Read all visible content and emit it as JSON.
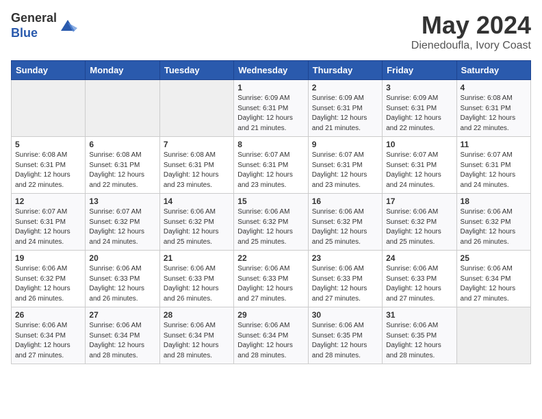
{
  "header": {
    "logo_line1": "General",
    "logo_line2": "Blue",
    "title": "May 2024",
    "location": "Dienedoufla, Ivory Coast"
  },
  "weekdays": [
    "Sunday",
    "Monday",
    "Tuesday",
    "Wednesday",
    "Thursday",
    "Friday",
    "Saturday"
  ],
  "weeks": [
    [
      {
        "num": "",
        "info": ""
      },
      {
        "num": "",
        "info": ""
      },
      {
        "num": "",
        "info": ""
      },
      {
        "num": "1",
        "info": "Sunrise: 6:09 AM\nSunset: 6:31 PM\nDaylight: 12 hours\nand 21 minutes."
      },
      {
        "num": "2",
        "info": "Sunrise: 6:09 AM\nSunset: 6:31 PM\nDaylight: 12 hours\nand 21 minutes."
      },
      {
        "num": "3",
        "info": "Sunrise: 6:09 AM\nSunset: 6:31 PM\nDaylight: 12 hours\nand 22 minutes."
      },
      {
        "num": "4",
        "info": "Sunrise: 6:08 AM\nSunset: 6:31 PM\nDaylight: 12 hours\nand 22 minutes."
      }
    ],
    [
      {
        "num": "5",
        "info": "Sunrise: 6:08 AM\nSunset: 6:31 PM\nDaylight: 12 hours\nand 22 minutes."
      },
      {
        "num": "6",
        "info": "Sunrise: 6:08 AM\nSunset: 6:31 PM\nDaylight: 12 hours\nand 22 minutes."
      },
      {
        "num": "7",
        "info": "Sunrise: 6:08 AM\nSunset: 6:31 PM\nDaylight: 12 hours\nand 23 minutes."
      },
      {
        "num": "8",
        "info": "Sunrise: 6:07 AM\nSunset: 6:31 PM\nDaylight: 12 hours\nand 23 minutes."
      },
      {
        "num": "9",
        "info": "Sunrise: 6:07 AM\nSunset: 6:31 PM\nDaylight: 12 hours\nand 23 minutes."
      },
      {
        "num": "10",
        "info": "Sunrise: 6:07 AM\nSunset: 6:31 PM\nDaylight: 12 hours\nand 24 minutes."
      },
      {
        "num": "11",
        "info": "Sunrise: 6:07 AM\nSunset: 6:31 PM\nDaylight: 12 hours\nand 24 minutes."
      }
    ],
    [
      {
        "num": "12",
        "info": "Sunrise: 6:07 AM\nSunset: 6:31 PM\nDaylight: 12 hours\nand 24 minutes."
      },
      {
        "num": "13",
        "info": "Sunrise: 6:07 AM\nSunset: 6:32 PM\nDaylight: 12 hours\nand 24 minutes."
      },
      {
        "num": "14",
        "info": "Sunrise: 6:06 AM\nSunset: 6:32 PM\nDaylight: 12 hours\nand 25 minutes."
      },
      {
        "num": "15",
        "info": "Sunrise: 6:06 AM\nSunset: 6:32 PM\nDaylight: 12 hours\nand 25 minutes."
      },
      {
        "num": "16",
        "info": "Sunrise: 6:06 AM\nSunset: 6:32 PM\nDaylight: 12 hours\nand 25 minutes."
      },
      {
        "num": "17",
        "info": "Sunrise: 6:06 AM\nSunset: 6:32 PM\nDaylight: 12 hours\nand 25 minutes."
      },
      {
        "num": "18",
        "info": "Sunrise: 6:06 AM\nSunset: 6:32 PM\nDaylight: 12 hours\nand 26 minutes."
      }
    ],
    [
      {
        "num": "19",
        "info": "Sunrise: 6:06 AM\nSunset: 6:32 PM\nDaylight: 12 hours\nand 26 minutes."
      },
      {
        "num": "20",
        "info": "Sunrise: 6:06 AM\nSunset: 6:33 PM\nDaylight: 12 hours\nand 26 minutes."
      },
      {
        "num": "21",
        "info": "Sunrise: 6:06 AM\nSunset: 6:33 PM\nDaylight: 12 hours\nand 26 minutes."
      },
      {
        "num": "22",
        "info": "Sunrise: 6:06 AM\nSunset: 6:33 PM\nDaylight: 12 hours\nand 27 minutes."
      },
      {
        "num": "23",
        "info": "Sunrise: 6:06 AM\nSunset: 6:33 PM\nDaylight: 12 hours\nand 27 minutes."
      },
      {
        "num": "24",
        "info": "Sunrise: 6:06 AM\nSunset: 6:33 PM\nDaylight: 12 hours\nand 27 minutes."
      },
      {
        "num": "25",
        "info": "Sunrise: 6:06 AM\nSunset: 6:34 PM\nDaylight: 12 hours\nand 27 minutes."
      }
    ],
    [
      {
        "num": "26",
        "info": "Sunrise: 6:06 AM\nSunset: 6:34 PM\nDaylight: 12 hours\nand 27 minutes."
      },
      {
        "num": "27",
        "info": "Sunrise: 6:06 AM\nSunset: 6:34 PM\nDaylight: 12 hours\nand 28 minutes."
      },
      {
        "num": "28",
        "info": "Sunrise: 6:06 AM\nSunset: 6:34 PM\nDaylight: 12 hours\nand 28 minutes."
      },
      {
        "num": "29",
        "info": "Sunrise: 6:06 AM\nSunset: 6:34 PM\nDaylight: 12 hours\nand 28 minutes."
      },
      {
        "num": "30",
        "info": "Sunrise: 6:06 AM\nSunset: 6:35 PM\nDaylight: 12 hours\nand 28 minutes."
      },
      {
        "num": "31",
        "info": "Sunrise: 6:06 AM\nSunset: 6:35 PM\nDaylight: 12 hours\nand 28 minutes."
      },
      {
        "num": "",
        "info": ""
      }
    ]
  ],
  "colors": {
    "header_bg": "#2a5aad",
    "accent": "#2a5aad"
  }
}
